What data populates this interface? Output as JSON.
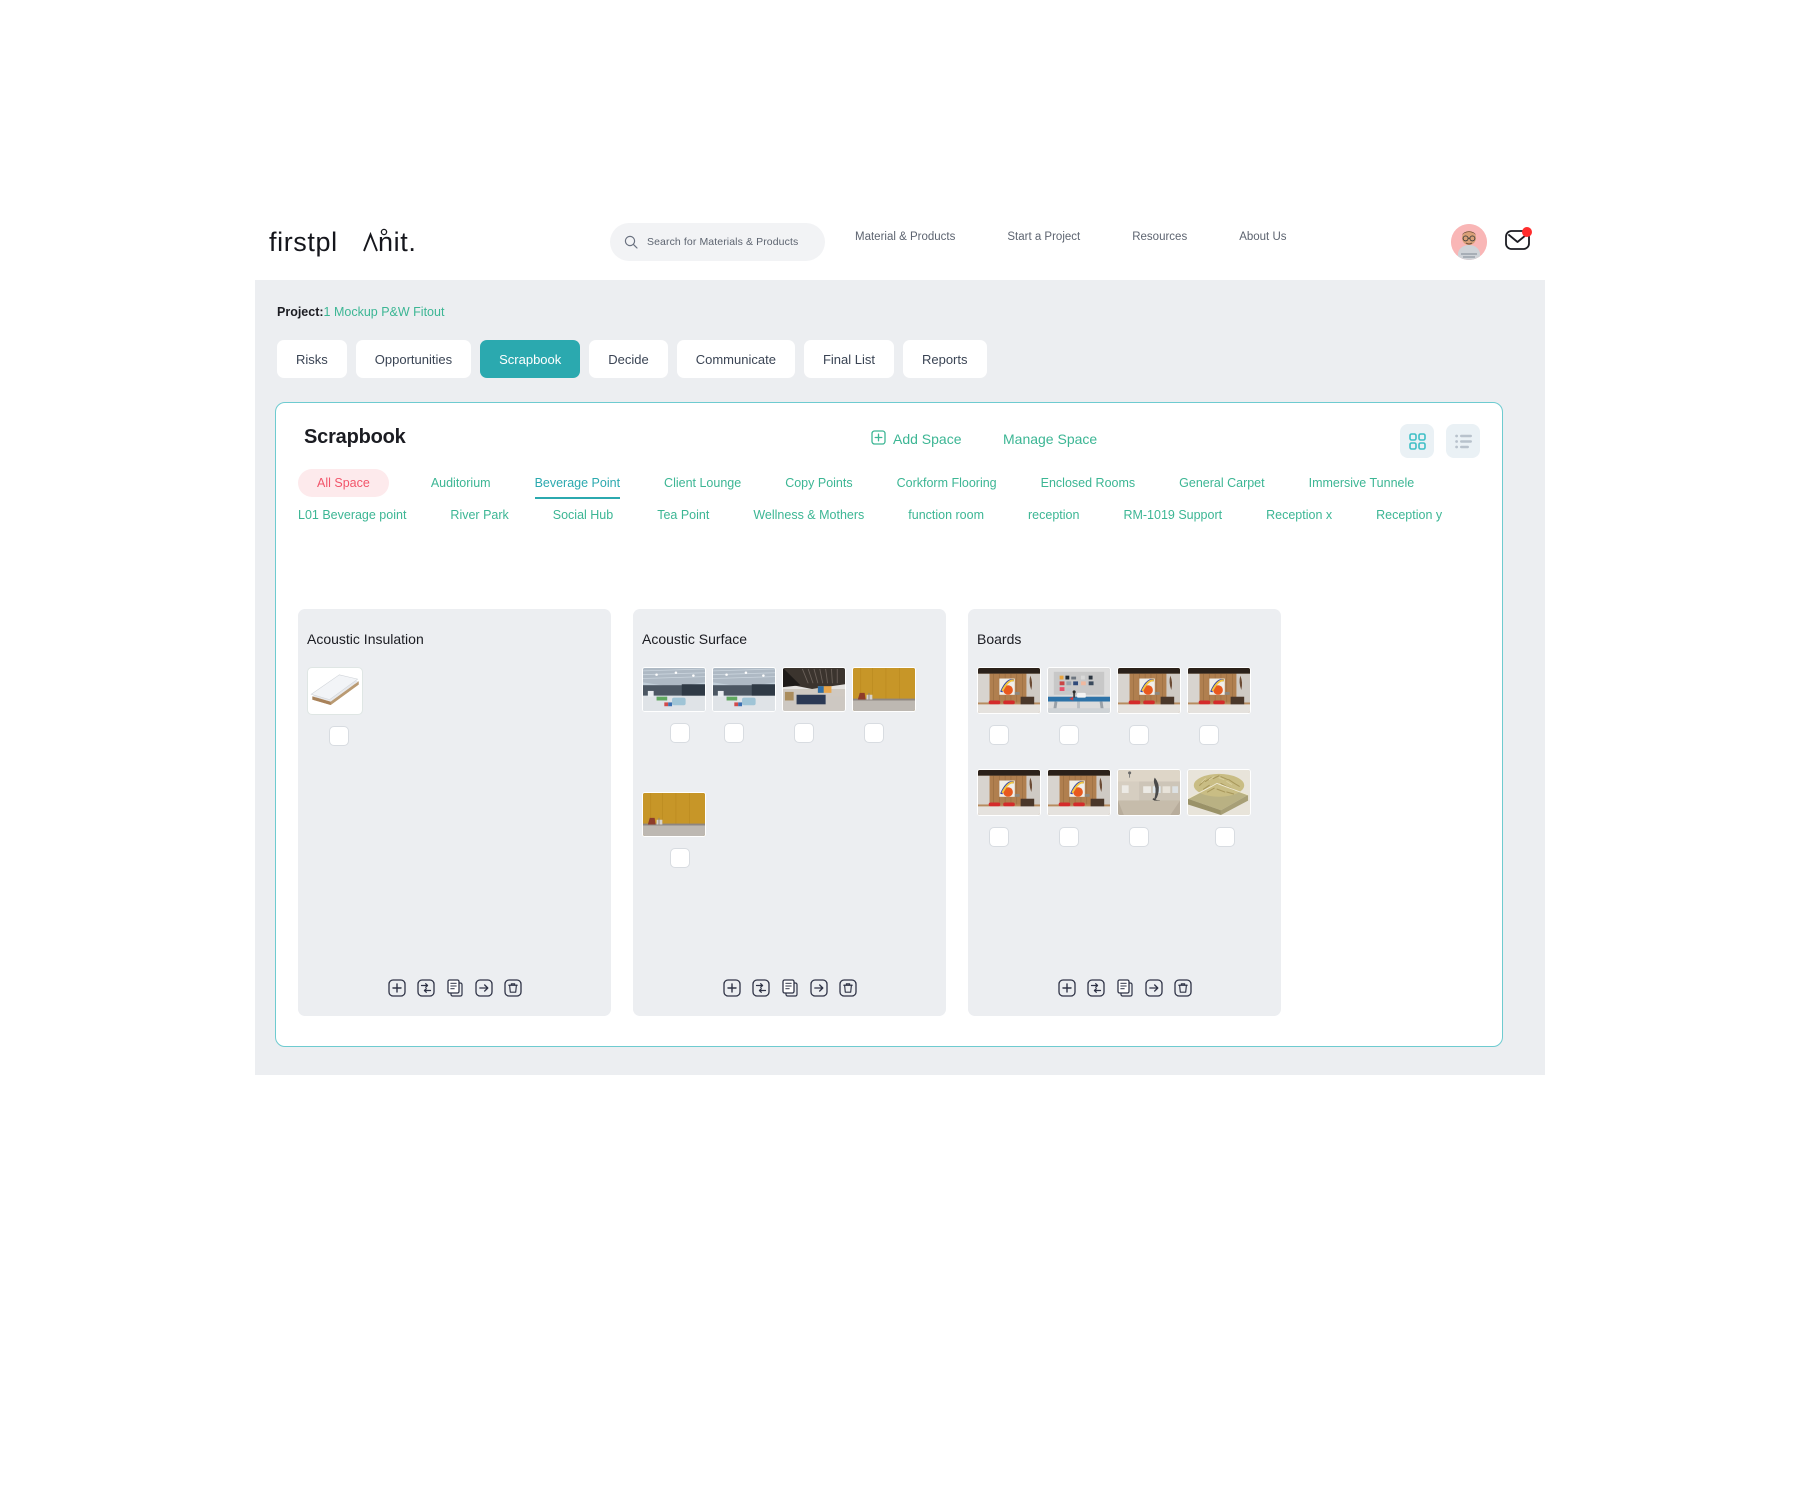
{
  "header": {
    "brand": "firstplanit.",
    "search": {
      "placeholder": "Search for Materials & Products",
      "icon": "search-icon"
    },
    "nav": [
      {
        "label": "Material & Products"
      },
      {
        "label": "Start a Project"
      },
      {
        "label": "Resources"
      },
      {
        "label": "About Us"
      }
    ],
    "avatar_icon": "user-avatar",
    "mail_icon": "mail-icon",
    "mail_badge": true
  },
  "project": {
    "label": "Project:",
    "name": "1 Mockup P&W Fitout"
  },
  "tabs": [
    {
      "label": "Risks",
      "active": false
    },
    {
      "label": "Opportunities",
      "active": false
    },
    {
      "label": "Scrapbook",
      "active": true
    },
    {
      "label": "Decide",
      "active": false
    },
    {
      "label": "Communicate",
      "active": false
    },
    {
      "label": "Final List",
      "active": false
    },
    {
      "label": "Reports",
      "active": false
    }
  ],
  "panel": {
    "title": "Scrapbook",
    "add_space_label": "Add Space",
    "add_space_icon": "plus-square-icon",
    "manage_space_label": "Manage Space",
    "view_grid_icon": "grid-view-icon",
    "view_list_icon": "list-view-icon",
    "view_active": "grid"
  },
  "colors": {
    "teal": "#2ba9af",
    "green": "#3cb694",
    "red": "#f2556a",
    "red_bg": "#fdeaec",
    "panel_border": "#6ecbd0",
    "card_bg": "#eceef1",
    "page_bg": "#eceef1"
  },
  "spaces": [
    {
      "label": "All Space",
      "state": "all"
    },
    {
      "label": "Auditorium",
      "state": "normal"
    },
    {
      "label": "Beverage Point",
      "state": "selected"
    },
    {
      "label": "Client Lounge",
      "state": "normal"
    },
    {
      "label": "Copy Points",
      "state": "normal"
    },
    {
      "label": "Corkform Flooring",
      "state": "normal"
    },
    {
      "label": "Enclosed Rooms",
      "state": "normal"
    },
    {
      "label": "General Carpet",
      "state": "normal"
    },
    {
      "label": "Immersive Tunnele",
      "state": "normal"
    },
    {
      "label": "L01 Beverage point",
      "state": "normal"
    },
    {
      "label": "River Park",
      "state": "normal"
    },
    {
      "label": "Social Hub",
      "state": "normal"
    },
    {
      "label": "Tea Point",
      "state": "normal"
    },
    {
      "label": "Wellness & Mothers",
      "state": "normal"
    },
    {
      "label": "function room",
      "state": "normal"
    },
    {
      "label": "reception",
      "state": "normal"
    },
    {
      "label": "RM-1019 Support",
      "state": "normal"
    },
    {
      "label": "Reception x",
      "state": "normal"
    },
    {
      "label": "Reception y",
      "state": "normal"
    }
  ],
  "cards": [
    {
      "title": "Acoustic Insulation",
      "items": [
        {
          "thumb": "insulation-board",
          "checked": false
        }
      ]
    },
    {
      "title": "Acoustic Surface",
      "items": [
        {
          "thumb": "office-ceiling-blue",
          "checked": false
        },
        {
          "thumb": "office-ceiling-blue",
          "checked": false
        },
        {
          "thumb": "dark-baffle-ceiling",
          "checked": false
        },
        {
          "thumb": "ochre-wall-panel",
          "checked": false
        },
        {
          "thumb": "ochre-wall-panel",
          "checked": false
        }
      ]
    },
    {
      "title": "Boards",
      "items": [
        {
          "thumb": "timber-room-artwork",
          "checked": false
        },
        {
          "thumb": "pinboard-desk",
          "checked": false
        },
        {
          "thumb": "timber-room-artwork",
          "checked": false
        },
        {
          "thumb": "timber-room-artwork",
          "checked": false
        },
        {
          "thumb": "timber-room-artwork",
          "checked": false
        },
        {
          "thumb": "timber-room-artwork",
          "checked": false
        },
        {
          "thumb": "gallery-interior",
          "checked": false
        },
        {
          "thumb": "straw-material",
          "checked": false
        }
      ]
    }
  ],
  "card_actions": [
    {
      "name": "add",
      "icon": "plus-square-icon"
    },
    {
      "name": "swap",
      "icon": "swap-arrows-icon"
    },
    {
      "name": "copy",
      "icon": "copy-icon"
    },
    {
      "name": "move",
      "icon": "arrow-right-square-icon"
    },
    {
      "name": "delete",
      "icon": "trash-icon"
    }
  ]
}
